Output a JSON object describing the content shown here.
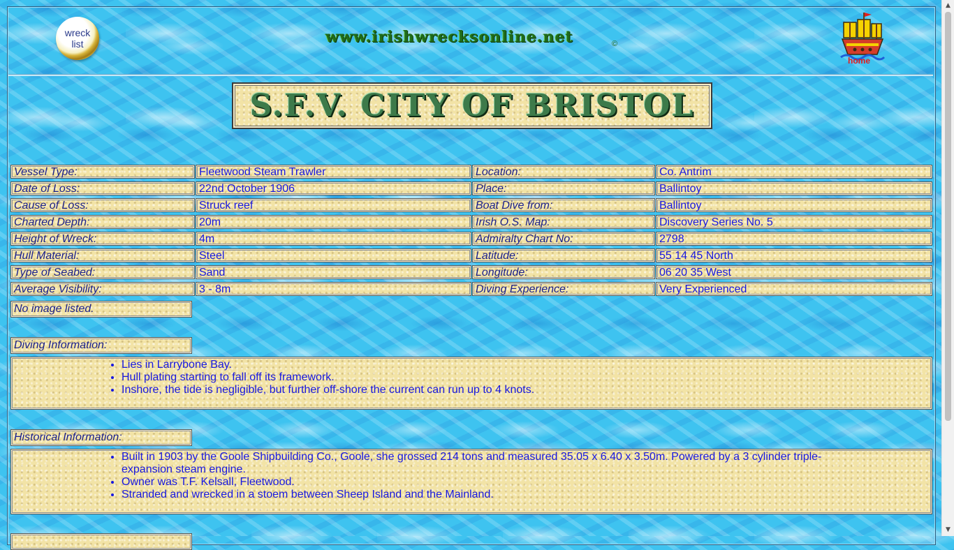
{
  "header": {
    "wreck_list_line1": "wreck",
    "wreck_list_line2": "list",
    "site_title": "www.irishwrecksonline.net",
    "copyright": "©",
    "home_label": "home"
  },
  "page_title": "S.F.V. CITY OF BRISTOL",
  "details": {
    "rows": [
      {
        "label1": "Vessel Type:",
        "value1": "Fleetwood Steam Trawler",
        "label2": "Location:",
        "value2": "Co. Antrim"
      },
      {
        "label1": "Date of Loss:",
        "value1": "22nd October 1906",
        "label2": "Place:",
        "value2": "Ballintoy"
      },
      {
        "label1": "Cause of Loss:",
        "value1": "Struck reef",
        "label2": "Boat Dive from:",
        "value2": "Ballintoy"
      },
      {
        "label1": "Charted Depth:",
        "value1": "20m",
        "label2": "Irish O.S. Map:",
        "value2": "Discovery Series No. 5"
      },
      {
        "label1": "Height of Wreck:",
        "value1": "4m",
        "label2": "Admiralty Chart No:",
        "value2": "2798"
      },
      {
        "label1": "Hull Material:",
        "value1": "Steel",
        "label2": "Latitude:",
        "value2": "55 14 45 North"
      },
      {
        "label1": "Type of Seabed:",
        "value1": "Sand",
        "label2": "Longitude:",
        "value2": "06 20 35 West"
      },
      {
        "label1": "Average Visibility:",
        "value1": "3 - 8m",
        "label2": "Diving Experience:",
        "value2": "Very Experienced"
      }
    ]
  },
  "no_image": "No image listed.",
  "diving": {
    "heading": "Diving Information:",
    "items": [
      "Lies in Larrybone Bay.",
      "Hull plating starting to fall off its framework.",
      "Inshore, the tide is negligible, but further off-shore the current can run up to 4 knots."
    ]
  },
  "historical": {
    "heading": "Historical Information:",
    "items": [
      "Built in 1903 by the Goole Shipbuilding Co., Goole, she grossed 214 tons and measured 35.05 x 6.40 x 3.50m. Powered by a 3 cylinder triple-expansion steam engine.",
      "Owner was T.F. Kelsall, Fleetwood.",
      "Stranded and wrecked in a stoem between Sheep Island and the Mainland."
    ]
  },
  "icons": {
    "wreck_list": "porthole-icon",
    "home": "ship-icon",
    "scroll_up": "arrow-up-icon",
    "scroll_down": "arrow-down-icon"
  },
  "colors": {
    "water": "#3ec3f0",
    "sand": "#f2e3a6",
    "label_text": "#1a1f8a",
    "value_text": "#1818e0",
    "title_green": "#3d7a4a"
  }
}
